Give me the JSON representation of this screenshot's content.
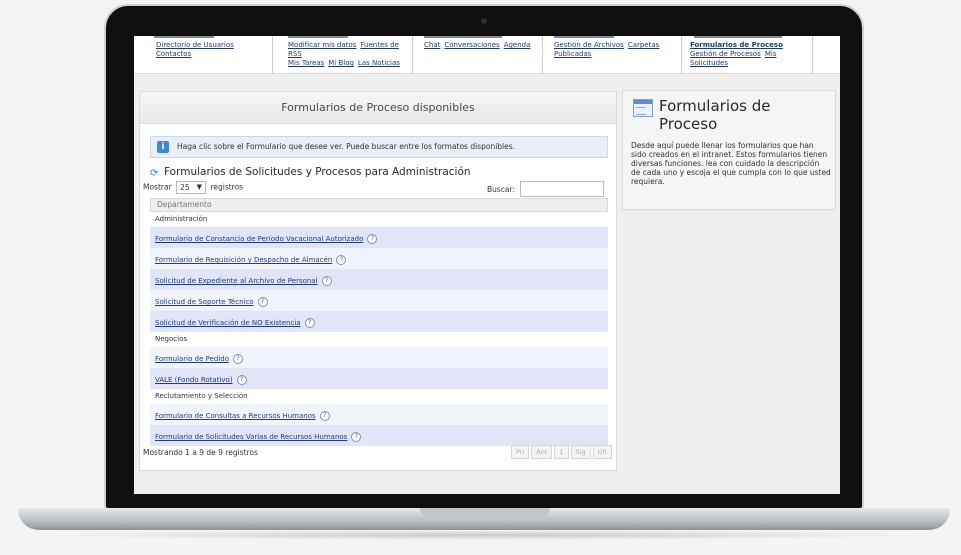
{
  "topmenu": {
    "col1": {
      "links": [
        "Directorio de Usuarios",
        "Contactos"
      ]
    },
    "col2": {
      "links": [
        "Modificar mis datos",
        "Fuentes de RSS",
        "Mis Tareas",
        "Mi Blog",
        "Las Noticias"
      ]
    },
    "col3": {
      "links": [
        "Chat",
        "Conversaciones",
        "Agenda"
      ]
    },
    "col4": {
      "links": [
        "Gestión de Archivos",
        "Carpetas Publicadas"
      ]
    },
    "col5": {
      "active": "Formularios de Proceso",
      "links": [
        "Gestión de Procesos",
        "Mis Solicitudes"
      ]
    }
  },
  "main": {
    "title": "Formularios de Proceso disponibles",
    "info": "Haga clic sobre el Formulario que desee ver. Puede buscar entre los formatos disponibles.",
    "section_title": "Formularios de Solicitudes y Procesos para Administración",
    "show_prefix": "Mostrar",
    "show_value": "25",
    "show_suffix": "registros",
    "search_label": "Buscar:",
    "search_value": "",
    "column_header": "Departamento",
    "groups": [
      {
        "name": "Administración",
        "items": [
          "Formulario de Constancia de Período Vacacional Autorizado",
          "Formulario de Requisición y Despacho de Almacén",
          "Solicitud de Expediente al Archivo de Personal",
          "Solicitud de Soporte Técnico",
          "Solicitud de Verificación de NO Existencia"
        ]
      },
      {
        "name": "Negocios",
        "items": [
          "Formulario de Pedido",
          "VALE (Fondo Rotativo)"
        ]
      },
      {
        "name": "Reclutamiento y Selección",
        "items": [
          "Formulario de Consultas a Recursos Humanos",
          "Formulario de Solicitudes Varias de Recursos Humanos"
        ]
      }
    ],
    "footer_info": "Mostrando 1 a 9 de 9 registros",
    "pager": [
      "Pri",
      "Ant",
      "1",
      "Sig",
      "Últ"
    ]
  },
  "side": {
    "title": "Formularios de Proceso",
    "description": "Desde aquí puede llenar los formularios que han sido creados en el intranet. Estos formularios tienen diversas funciones. lea con cuidado la descripción de cada uno y escoja el que cumpla con lo que usted requiera."
  }
}
